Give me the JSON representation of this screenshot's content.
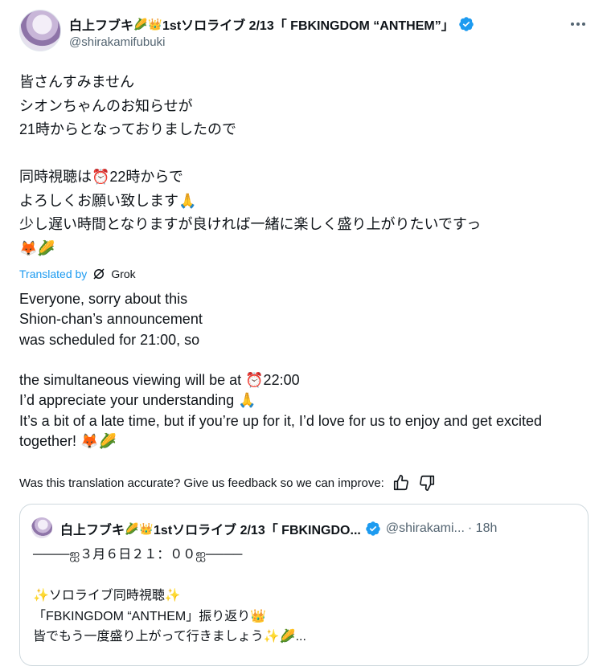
{
  "tweet": {
    "author_name": "白上フブキ",
    "author_title": "1stソロライブ 2/13「 FBKINGDOM “ANTHEM”」",
    "handle": "@shirakamifubuki",
    "body_jp": "皆さんすみません\nシオンちゃんのお知らせが\n21時からとなっておりましたので\n\n同時視聴は⏰22時からで\nよろしくお願い致します🙏\n少し遅い時間となりますが良ければ一緒に楽しく盛り上がりたいですっ\n🦊🌽",
    "translated_by": "Translated by",
    "translator": "Grok",
    "body_en": "Everyone, sorry about this\nShion-chan’s announcement\nwas scheduled for 21:00, so\n\nthe simultaneous viewing will be at ⏰22:00\nI’d appreciate your understanding 🙏\nIt’s a bit of a late time, but if you’re up for it, I’d love for us to enjoy and get excited together! 🦊🌽",
    "feedback_prompt": "Was this translation accurate? Give us feedback so we can improve:"
  },
  "quote": {
    "author_name": "白上フブキ",
    "author_title": "1stソロライブ 2/13「 FBKINGDO...",
    "handle": "@shirakami...",
    "time": "· 18h",
    "body": "────ஐ３月６日２１：００ஐ────\n\n✨ソロライブ同時視聴✨\n「FBKINGDOM “ANTHEM」振り返り👑\n皆でもう一度盛り上がって行きましょう✨🌽..."
  },
  "colors": {
    "accent": "#1d9bf0",
    "text": "#0f1419",
    "muted": "#536471",
    "border": "#cfd9de"
  },
  "icons": [
    "corn-icon",
    "crown-icon",
    "verified-badge-icon",
    "more-icon",
    "grok-icon",
    "thumbs-up-icon",
    "thumbs-down-icon"
  ]
}
